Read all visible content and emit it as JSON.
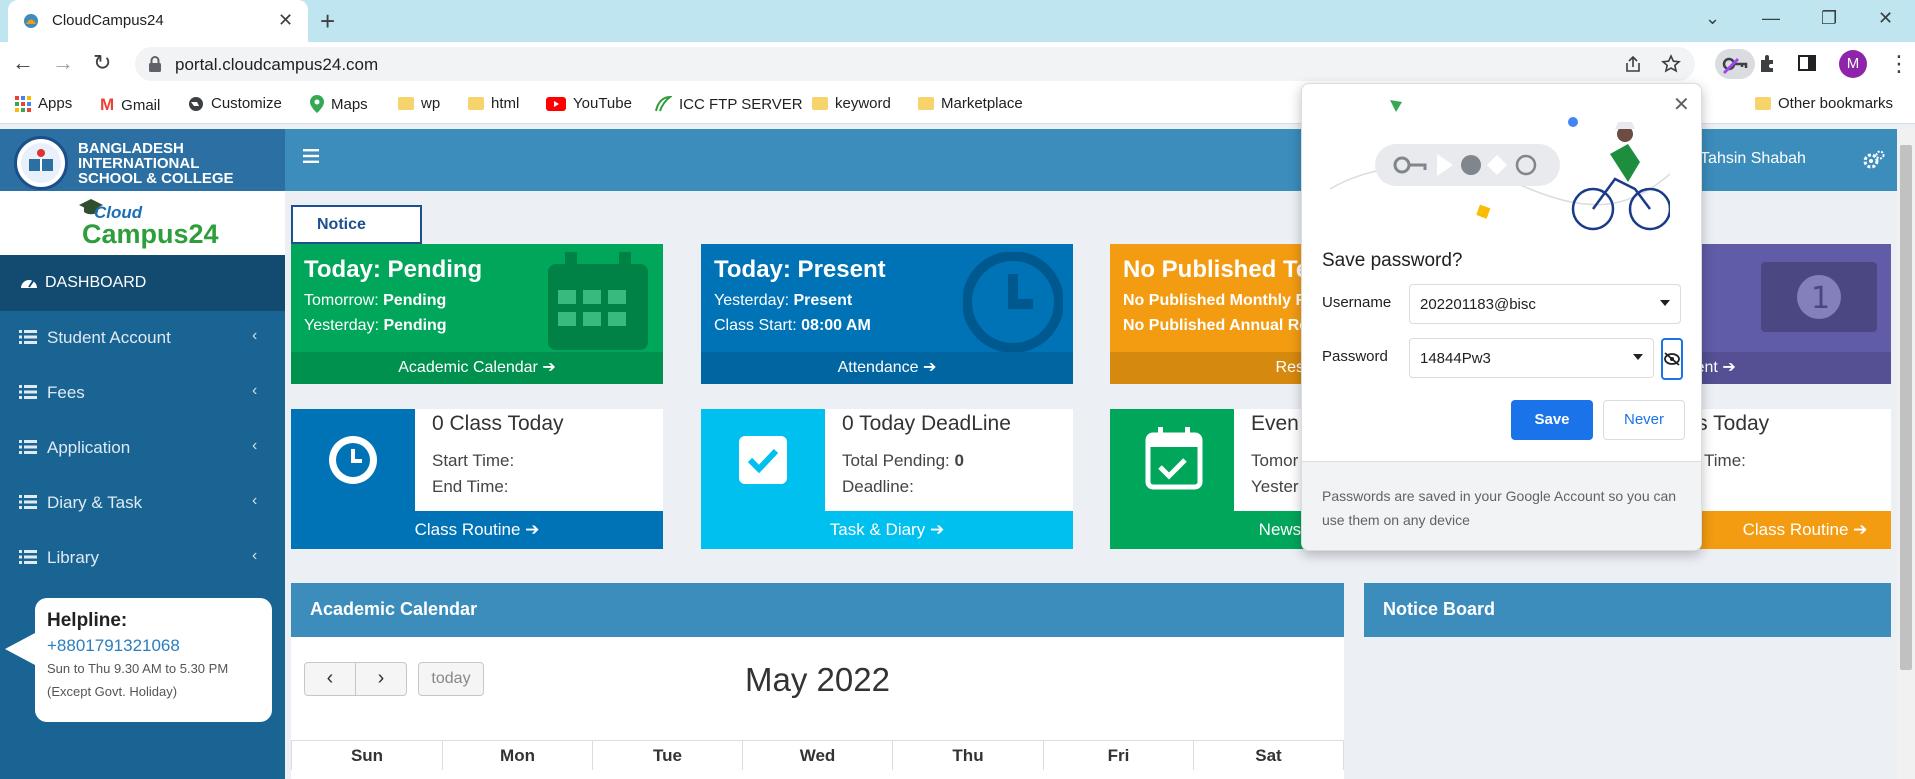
{
  "browser": {
    "tab_title": "CloudCampus24",
    "url": "portal.cloudcampus24.com",
    "avatar_letter": "M",
    "bookmarks": [
      "Apps",
      "Gmail",
      "Customize",
      "Maps",
      "wp",
      "html",
      "YouTube",
      "ICC FTP SERVER",
      "keyword",
      "Marketplace"
    ],
    "other_bookmarks": "Other bookmarks"
  },
  "school": {
    "name_line1": "BANGLADESH",
    "name_line2": "INTERNATIONAL",
    "name_line3": "SCHOOL & COLLEGE",
    "logo_word1": "Cloud",
    "logo_word2": "Campus24"
  },
  "sidebar": {
    "dashboard": "DASHBOARD",
    "items": [
      {
        "label": "Student Account"
      },
      {
        "label": "Fees"
      },
      {
        "label": "Application"
      },
      {
        "label": "Diary & Task"
      },
      {
        "label": "Library"
      }
    ],
    "helpline": {
      "title": "Helpline:",
      "phone": "+8801791321068",
      "hours": "Sun to Thu 9.30 AM to 5.30 PM",
      "note": "(Except Govt. Holiday)"
    }
  },
  "topbar": {
    "user_name": "h Tahsin Shabah"
  },
  "notice_tab": "Notice",
  "cards": [
    {
      "title": "Today: Pending",
      "line1_label": "Tomorrow: ",
      "line1_value": "Pending",
      "line2_label": "Yesterday: ",
      "line2_value": "Pending",
      "footer": "Academic Calendar",
      "color": "#00a65a"
    },
    {
      "title": "Today: Present",
      "line1_label": "Yesterday: ",
      "line1_value": "Present",
      "line2_label": "Class Start: ",
      "line2_value": "08:00 AM",
      "footer": "Attendance",
      "color": "#0073b7"
    },
    {
      "title": "No Published Te",
      "line1_label": "",
      "line1_value": "No Published Monthly R",
      "line2_label": "",
      "line2_value": "No Published Annual Re",
      "footer": "Resul",
      "color": "#f39c12"
    },
    {
      "title": "",
      "line1_label": "",
      "line1_value": "",
      "line2_label": "",
      "line2_value": "",
      "footer": "yment",
      "color": "#605ca8"
    }
  ],
  "info_boxes": [
    {
      "title": "0 Class Today",
      "row1_label": "Start Time:",
      "row1_value": "",
      "row2_label": "End Time:",
      "row2_value": "",
      "footer": "Class Routine",
      "color": "#0073b7"
    },
    {
      "title": "0 Today DeadLine",
      "row1_label": "Total Pending: ",
      "row1_value": "0",
      "row2_label": "Deadline:",
      "row2_value": "",
      "footer": "Task & Diary",
      "color": "#00c0ef"
    },
    {
      "title": "Even",
      "row1_label": "Tomor",
      "row1_value": "",
      "row2_label": "Yester",
      "row2_value": "",
      "footer": "News & E",
      "color": "#00a65a"
    },
    {
      "title": "ass Today",
      "row1_label": "Time:",
      "row1_value": "",
      "row2_label": "",
      "row2_value": "",
      "footer": "Class Routine",
      "color": "#f39c12"
    }
  ],
  "calendar": {
    "header": "Academic Calendar",
    "today_btn": "today",
    "month": "May 2022",
    "weekdays": [
      "Sun",
      "Mon",
      "Tue",
      "Wed",
      "Thu",
      "Fri",
      "Sat"
    ]
  },
  "notice_board": {
    "header": "Notice Board"
  },
  "save_password": {
    "question": "Save password?",
    "username_label": "Username",
    "username_value": "202201183@bisc",
    "password_label": "Password",
    "password_value": "14844Pw3",
    "save_button": "Save",
    "never_button": "Never",
    "footnote": "Passwords are saved in your Google Account so you can use them on any device"
  }
}
